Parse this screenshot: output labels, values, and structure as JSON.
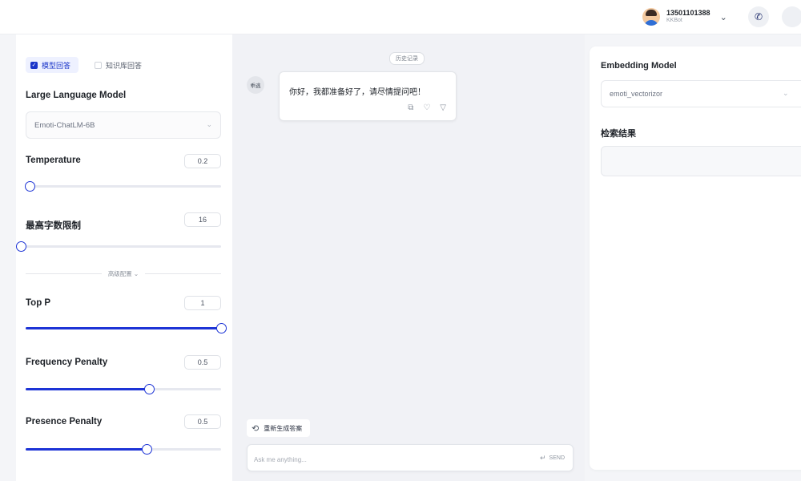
{
  "header": {
    "user_phone": "13501101388",
    "user_sub": "KKBot"
  },
  "left_panel": {
    "modes": [
      {
        "label": "模型回答",
        "active": true
      },
      {
        "label": "知识库回答",
        "active": false
      }
    ],
    "llm_label": "Large Language Model",
    "llm_value": "Emoti-ChatLM-6B",
    "divider_label": "高级配置",
    "params": [
      {
        "key": "temperature",
        "label": "Temperature",
        "value": "0.2",
        "fraction": 0.02
      },
      {
        "key": "max_tokens",
        "label": "最高字数限制",
        "value": "16",
        "fraction": 0.0
      },
      {
        "key": "top_p",
        "label": "Top P",
        "value": "1",
        "fraction": 1.0
      },
      {
        "key": "frequency_penalty",
        "label": "Frequency Penalty",
        "value": "0.5",
        "fraction": 0.63
      },
      {
        "key": "presence_penalty",
        "label": "Presence Penalty",
        "value": "0.5",
        "fraction": 0.62
      }
    ]
  },
  "chat": {
    "history_label": "历史记录",
    "bot_avatar_label": "乖逃",
    "message": "你好，我都准备好了，请尽情提问吧！",
    "regen_label": "重新生成答案",
    "input_placeholder": "Ask me anything...",
    "send_label": "SEND"
  },
  "right_panel": {
    "embedding_label": "Embedding Model",
    "embedding_value": "emoti_vectorizor",
    "results_label": "检索结果"
  },
  "colors": {
    "accent": "#1d34d6",
    "mode_active_bg": "#eef1ff"
  }
}
